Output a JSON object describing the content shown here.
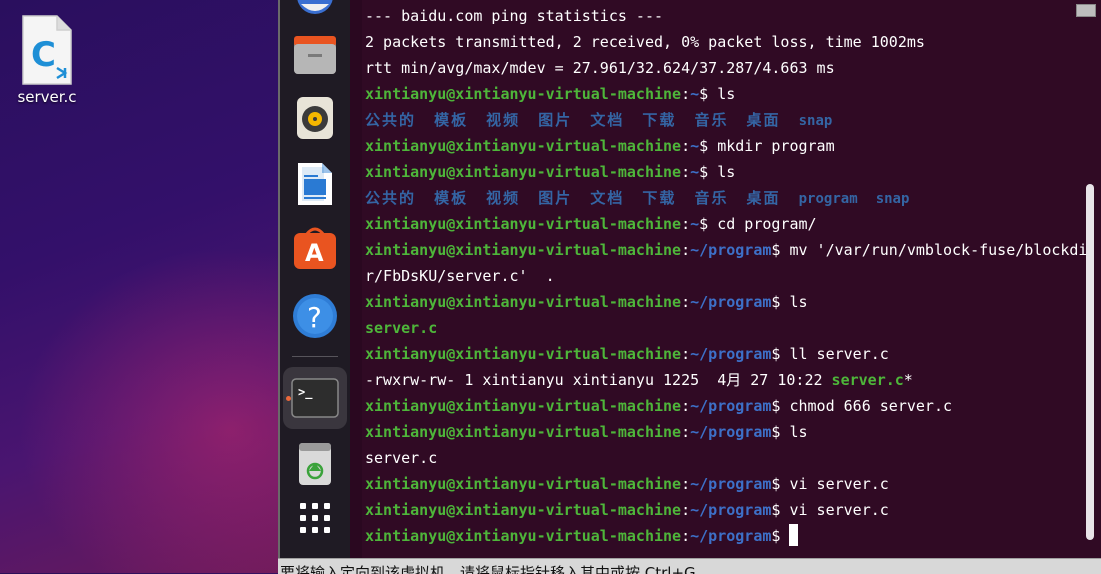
{
  "desktop": {
    "file_icon": {
      "name": "c-source-file-icon",
      "letter": "C",
      "label": "server.c"
    }
  },
  "dock": {
    "items": [
      {
        "name": "thunderbird-icon"
      },
      {
        "name": "files-icon"
      },
      {
        "name": "rhythmbox-icon"
      },
      {
        "name": "libreoffice-writer-icon"
      },
      {
        "name": "ubuntu-software-icon"
      },
      {
        "name": "help-icon",
        "glyph": "?"
      },
      {
        "name": "terminal-icon",
        "glyph": ">_"
      },
      {
        "name": "trash-icon"
      },
      {
        "name": "show-apps-icon"
      }
    ]
  },
  "terminal": {
    "user": "xintianyu@xintianyu-virtual-machine",
    "sep": ":",
    "home": "~",
    "prog": "~/program",
    "dollar": "$",
    "lines": {
      "l1": "--- baidu.com ping statistics ---",
      "l2": "2 packets transmitted, 2 received, 0% packet loss, time 1002ms",
      "l3": "rtt min/avg/max/mdev = 27.961/32.624/37.287/4.663 ms",
      "c4": " ls",
      "dirs1": [
        "公共的",
        "模板",
        "视频",
        "图片",
        "文档",
        "下载",
        "音乐",
        "桌面"
      ],
      "snap": "snap",
      "c6": " mkdir program",
      "c7": " ls",
      "program": "program",
      "c9": " cd program/",
      "c10a": " mv '/var/run/vmblock-fuse/blockdi",
      "c10b": "r/FbDsKU/server.c'  .",
      "c12": " ls",
      "out13": "server.c",
      "c14": " ll server.c",
      "out15a": "-rwxrw-rw- 1 xintianyu xintianyu 1225  4月 27 10:22 ",
      "out15b": "server.c",
      "out15c": "*",
      "c16": " chmod 666 server.c",
      "c17": " ls",
      "out18": "server.c",
      "c19": " vi server.c",
      "c20": " vi server.c"
    }
  },
  "notice": {
    "text": "要将输入定向到该虚拟机，请将鼠标指针移入其中或按 Ctrl+G。"
  }
}
